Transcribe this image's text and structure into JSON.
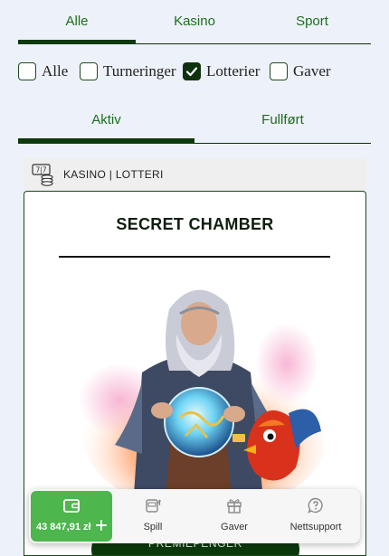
{
  "top_tabs": {
    "items": [
      "Alle",
      "Kasino",
      "Sport"
    ],
    "active": "Alle"
  },
  "filters": [
    {
      "label": "Alle",
      "checked": false
    },
    {
      "label": "Turneringer",
      "checked": false
    },
    {
      "label": "Lotterier",
      "checked": true
    },
    {
      "label": "Gaver",
      "checked": false
    }
  ],
  "status_tabs": {
    "items": [
      "Aktiv",
      "Fullført"
    ],
    "active": "Aktiv"
  },
  "card": {
    "category": "KASINO | LOTTERI",
    "category_icon": "lottery-ticket-icon",
    "title": "SECRET CHAMBER",
    "prize_label": "PREMIEPENGER"
  },
  "bottom_nav": {
    "wallet_amount": "43 847,91 zł",
    "wallet_icon": "wallet-icon",
    "items": [
      {
        "label": "Spill",
        "icon": "slot-machine-icon"
      },
      {
        "label": "Gaver",
        "icon": "gift-icon"
      },
      {
        "label": "Nettsupport",
        "icon": "help-chat-icon"
      }
    ]
  },
  "colors": {
    "accent_dark": "#0d3a0d",
    "accent_text": "#1c6e1c",
    "wallet": "#4db64d",
    "background": "#edf1f9"
  }
}
